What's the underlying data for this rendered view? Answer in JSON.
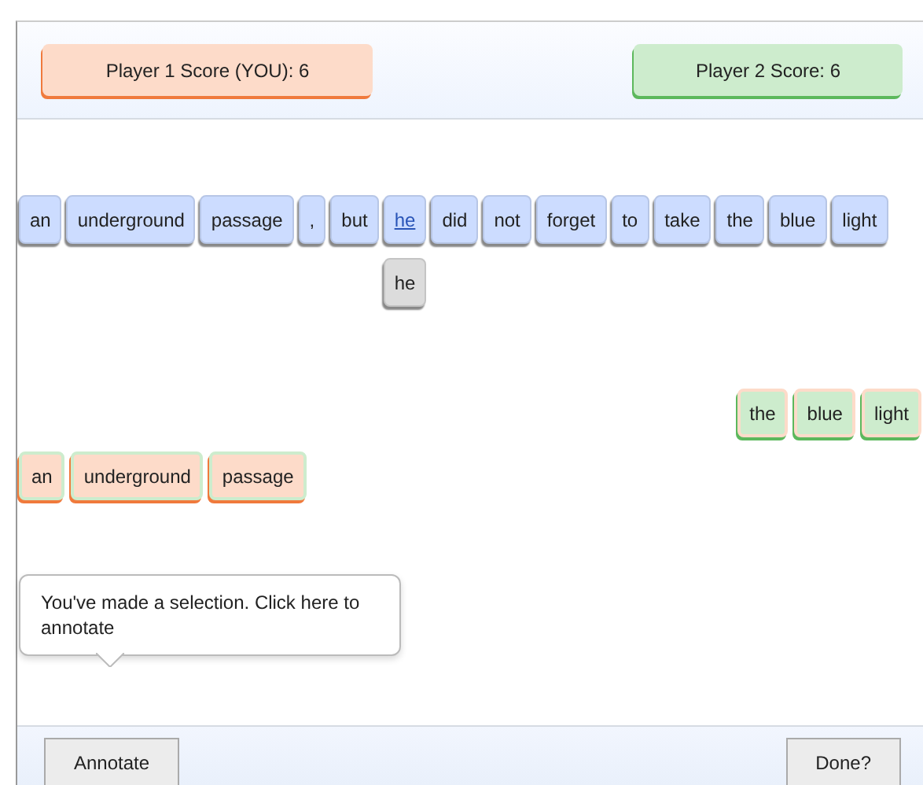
{
  "scores": [
    {
      "label": "Player 1 Score (YOU): 6",
      "kind": "p1"
    },
    {
      "label": "Player 2 Score: 6",
      "kind": "p2"
    }
  ],
  "words": [
    {
      "text": "an",
      "selected": false
    },
    {
      "text": "underground",
      "selected": false
    },
    {
      "text": "passage",
      "selected": false
    },
    {
      "text": ",",
      "selected": false
    },
    {
      "text": "but",
      "selected": false
    },
    {
      "text": "he",
      "selected": true,
      "suggestion": "he"
    },
    {
      "text": "did",
      "selected": false
    },
    {
      "text": "not",
      "selected": false
    },
    {
      "text": "forget",
      "selected": false
    },
    {
      "text": "to",
      "selected": false
    },
    {
      "text": "take",
      "selected": false
    },
    {
      "text": "the",
      "selected": false
    },
    {
      "text": "blue",
      "selected": false
    },
    {
      "text": "light",
      "selected": false
    }
  ],
  "player2_phrase": {
    "kind": "p2",
    "words": [
      "the",
      "blue",
      "light"
    ]
  },
  "player1_phrase": {
    "kind": "p1",
    "words": [
      "an",
      "underground",
      "passage"
    ]
  },
  "tooltip": "You've made a selection. Click here to annotate",
  "buttons": [
    {
      "label": "Annotate"
    },
    {
      "label": "Done?"
    }
  ]
}
